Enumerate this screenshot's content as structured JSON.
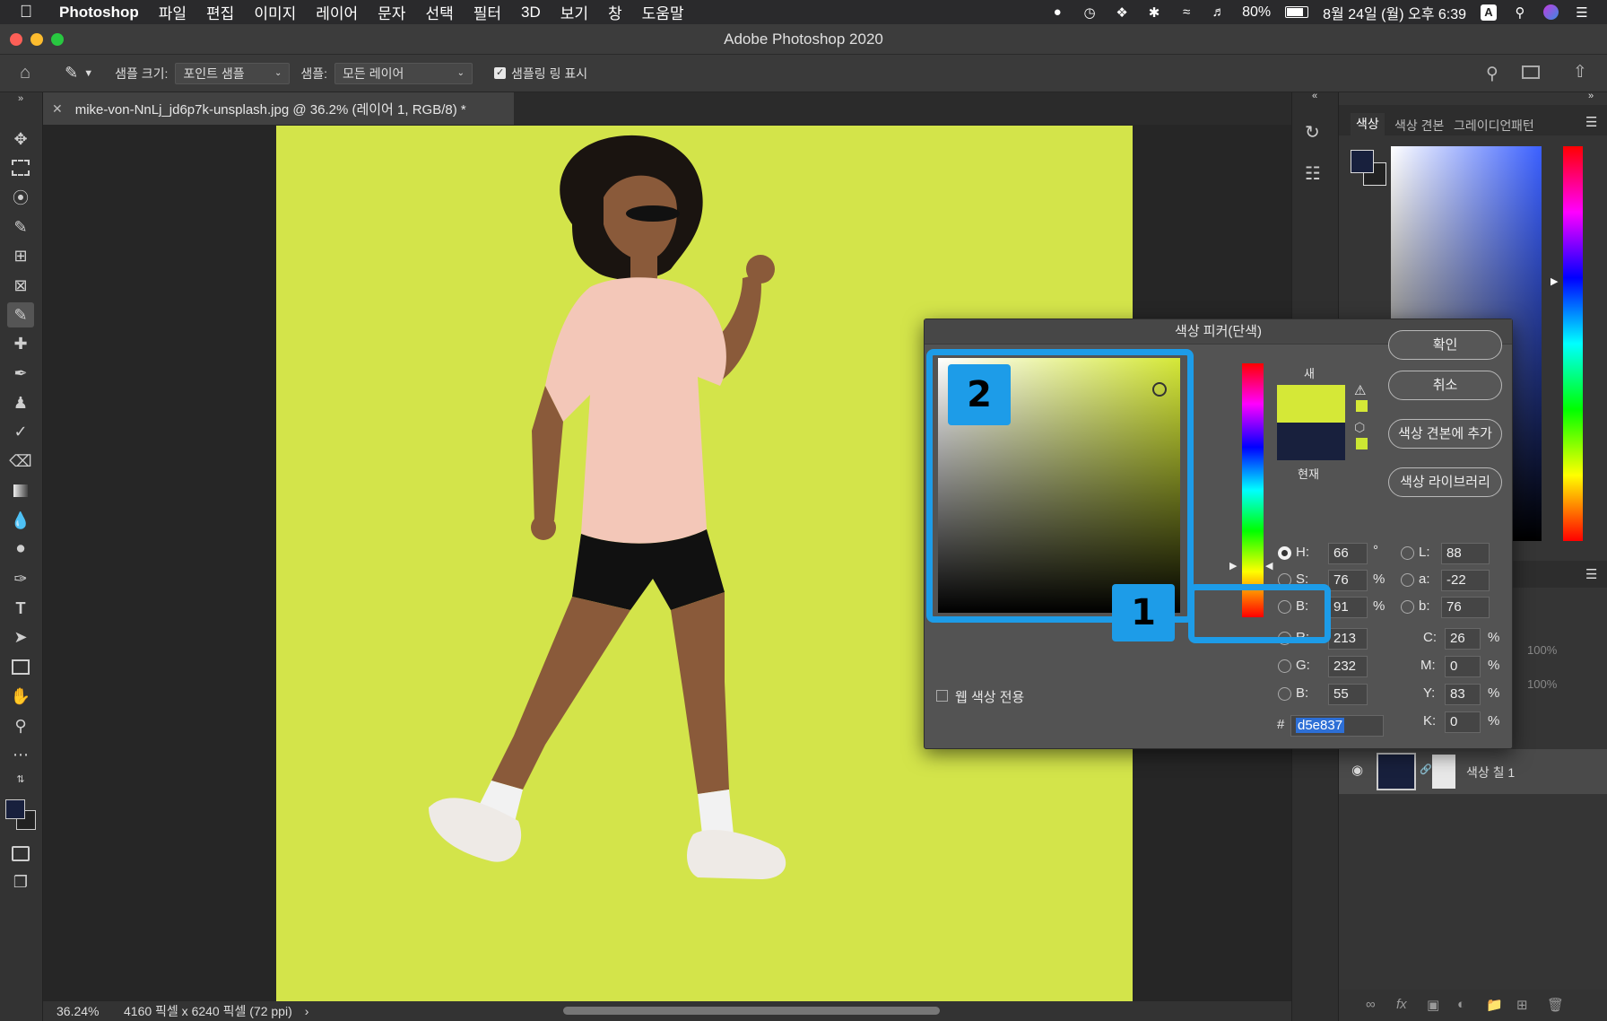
{
  "menubar": {
    "app": "Photoshop",
    "items": [
      "파일",
      "편집",
      "이미지",
      "레이어",
      "문자",
      "선택",
      "필터",
      "3D",
      "보기",
      "창",
      "도움말"
    ],
    "battery": "80%",
    "clock": "8월 24일 (월) 오후 6:39",
    "input_source": "A"
  },
  "window": {
    "title": "Adobe Photoshop 2020"
  },
  "options": {
    "sample_size_label": "샘플 크기:",
    "sample_size_value": "포인트 샘플",
    "sample_label": "샘플:",
    "sample_value": "모든 레이어",
    "show_ring_label": "샘플링 링 표시"
  },
  "document": {
    "tab_title": "mike-von-NnLj_jd6p7k-unsplash.jpg @ 36.2% (레이어 1, RGB/8) *",
    "background_color": "#d3e44a"
  },
  "status": {
    "zoom": "36.24%",
    "dimensions": "4160 픽셀 x 6240 픽셀 (72 ppi)"
  },
  "color_panel": {
    "tabs": [
      "색상",
      "색상 견본",
      "그레이디언",
      "패턴"
    ],
    "foreground": "#18203d",
    "background": "#222222"
  },
  "layers": {
    "opacity": "100%",
    "fill": "100%",
    "layer_name": "색상 칠 1"
  },
  "dialog": {
    "title": "색상 피커(단색)",
    "new_label": "새",
    "current_label": "현재",
    "new_color": "#d5e837",
    "current_color": "#18203d",
    "buttons": {
      "ok": "확인",
      "cancel": "취소",
      "add_swatch": "색상 견본에 추가",
      "libraries": "색상 라이브러리"
    },
    "web_only_label": "웹 색상 전용",
    "hsb": {
      "h_label": "H:",
      "h": "66",
      "h_unit": "°",
      "s_label": "S:",
      "s": "76",
      "s_unit": "%",
      "b_label": "B:",
      "b": "91",
      "b_unit": "%"
    },
    "lab": {
      "l_label": "L:",
      "l": "88",
      "a_label": "a:",
      "a": "-22",
      "b_label": "b:",
      "b": "76"
    },
    "rgb": {
      "r_label": "R:",
      "r": "213",
      "g_label": "G:",
      "g": "232",
      "b_label": "B:",
      "b": "55"
    },
    "cmyk": {
      "c_label": "C:",
      "c": "26",
      "m_label": "M:",
      "m": "0",
      "y_label": "Y:",
      "y": "83",
      "k_label": "K:",
      "k": "0",
      "unit": "%"
    },
    "hex_label": "#",
    "hex": "d5e837"
  },
  "callouts": {
    "one": "1",
    "two": "2"
  },
  "accent": "#1d9ce8"
}
